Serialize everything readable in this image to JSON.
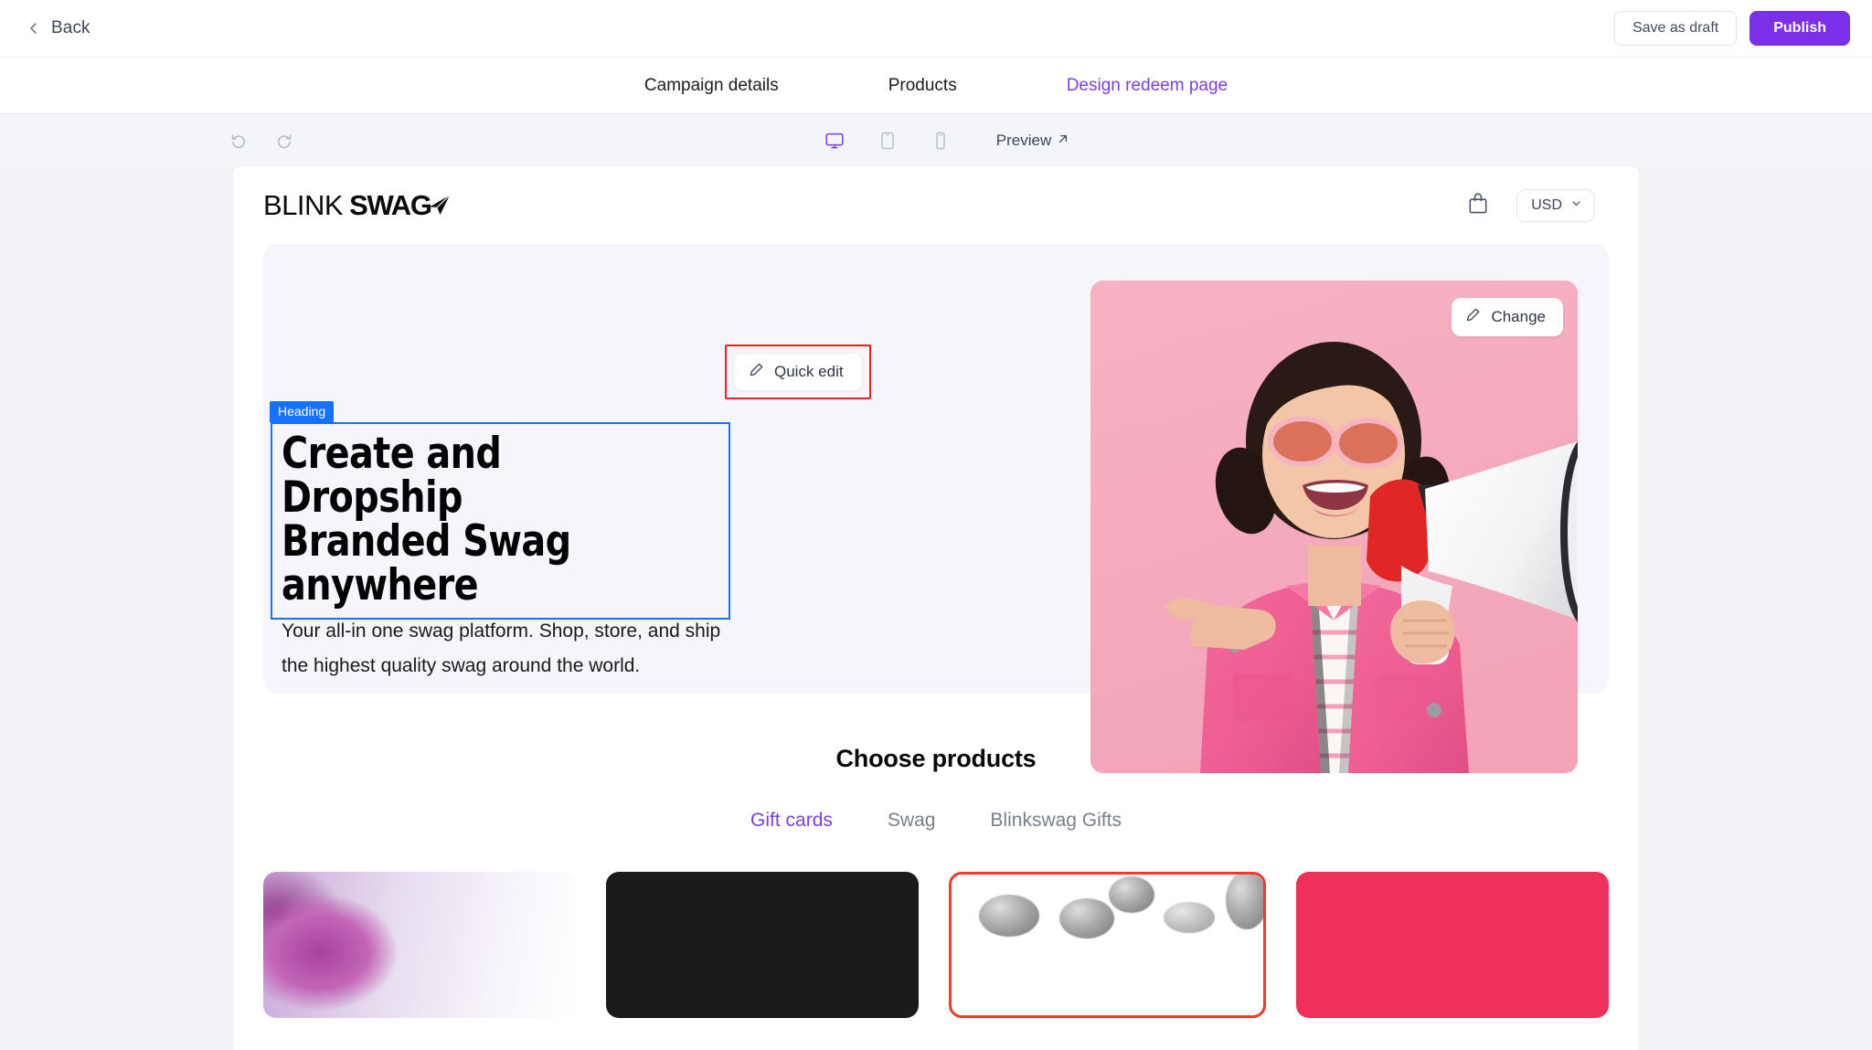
{
  "topbar": {
    "back_label": "Back",
    "back_icon": "chevron-left-icon",
    "save_draft_label": "Save as draft",
    "publish_label": "Publish",
    "publish_color": "#7B2FE8"
  },
  "tabs": [
    {
      "label": "Campaign details",
      "active": false
    },
    {
      "label": "Products",
      "active": false
    },
    {
      "label": "Design redeem page",
      "active": true
    }
  ],
  "editor_toolbar": {
    "undo_icon": "undo-icon",
    "redo_icon": "redo-icon",
    "devices": [
      {
        "name": "desktop-icon",
        "active": true
      },
      {
        "name": "tablet-icon",
        "active": false
      },
      {
        "name": "mobile-icon",
        "active": false
      }
    ],
    "preview_label": "Preview",
    "preview_icon": "external-link-arrow-icon",
    "active_color": "#7B3FE4"
  },
  "store": {
    "logo": {
      "part1": "BLINK",
      "part2": "SWAG",
      "mark": "paper-plane-icon"
    },
    "cart_icon": "shopping-bag-icon",
    "currency": {
      "value": "USD",
      "chevron": "chevron-down-icon"
    }
  },
  "hero": {
    "background": "#F6F5FC",
    "quick_edit": {
      "label": "Quick edit",
      "icon": "pencil-icon"
    },
    "selection": {
      "badge": "Heading",
      "badge_color": "#1472FF",
      "highlight_color": "#EF1D1D"
    },
    "title_line1": "Create and Dropship",
    "title_line2": "Branded Swag anywhere",
    "subtitle": "Your all-in one swag platform. Shop, store, and ship the highest quality swag around the world.",
    "image": {
      "alt": "woman-with-megaphone-photo",
      "change_label": "Change",
      "change_icon": "pencil-icon"
    }
  },
  "products": {
    "title": "Choose products",
    "tabs": [
      {
        "label": "Gift cards",
        "active": true
      },
      {
        "label": "Swag",
        "active": false
      },
      {
        "label": "Blinkswag Gifts",
        "active": false
      }
    ],
    "cards": [
      {
        "name": "product-card-rose",
        "color": "#C267B8",
        "selected": false
      },
      {
        "name": "product-card-black",
        "color": "#1C1B1B",
        "selected": false
      },
      {
        "name": "product-card-white-mugs",
        "color": "#FFFFFF",
        "selected": true
      },
      {
        "name": "product-card-pink",
        "color": "#EE3158",
        "selected": false
      }
    ]
  }
}
